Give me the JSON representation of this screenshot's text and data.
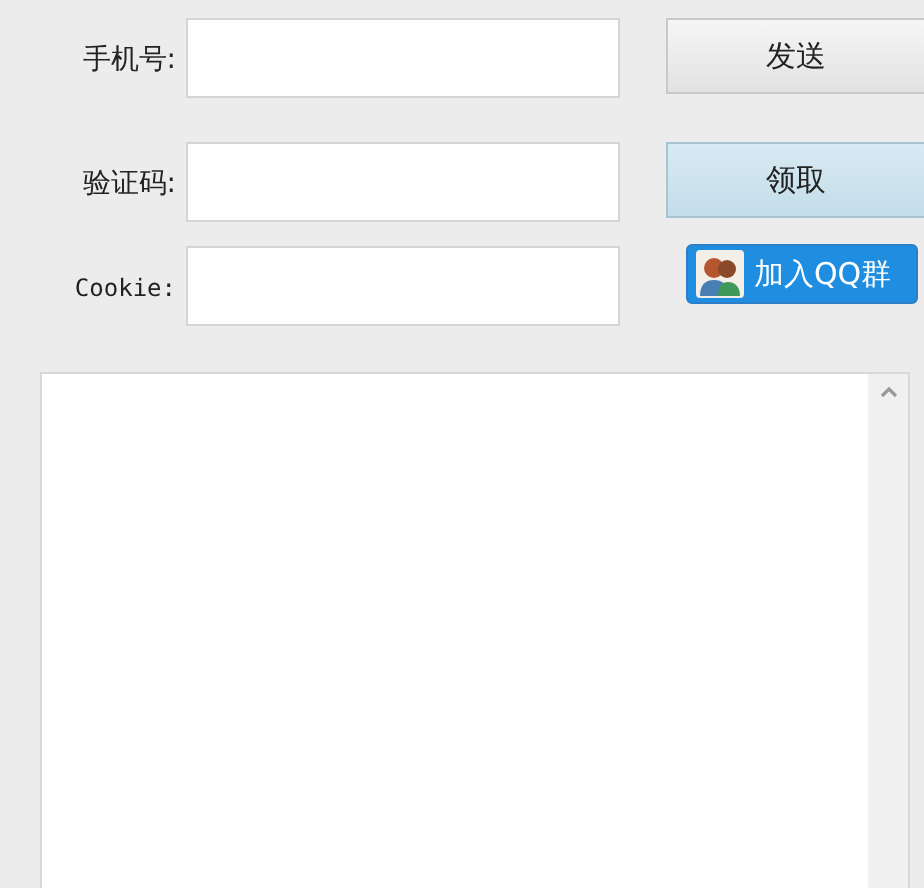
{
  "rows": [
    {
      "label": "手机号:",
      "button": {
        "kind": "plain",
        "label": "发送",
        "focused": false
      }
    },
    {
      "label": "验证码:",
      "button": {
        "kind": "plain",
        "label": "领取",
        "focused": true
      }
    },
    {
      "label": "Cookie:",
      "button": {
        "kind": "qq",
        "label": "加入QQ群",
        "focused": false
      }
    }
  ],
  "log": {
    "kind": "textarea"
  }
}
